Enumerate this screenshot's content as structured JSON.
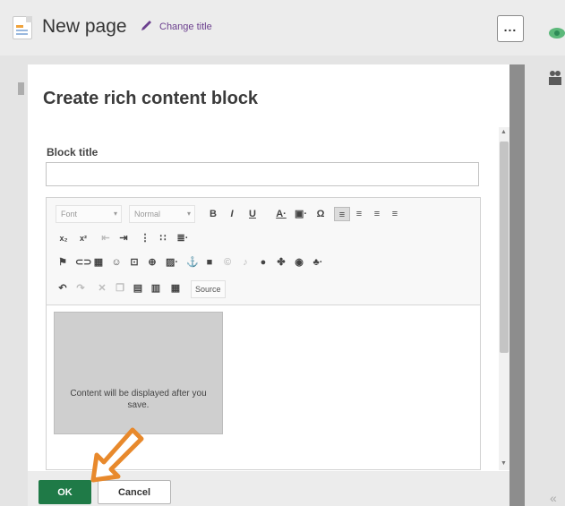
{
  "header": {
    "page_title": "New page",
    "change_title_label": "Change title",
    "more_label": "..."
  },
  "modal": {
    "title": "Create rich content block",
    "block_title_label": "Block title",
    "block_title_value": "",
    "toolbar": {
      "font_combo": "Font",
      "format_combo": "Normal",
      "source_label": "Source"
    },
    "content_placeholder": "Content will be displayed after you save.",
    "ok_label": "OK",
    "cancel_label": "Cancel"
  },
  "colors": {
    "ok_green": "#1f7a47",
    "accent_purple": "#6b3f8e",
    "callout_orange": "#e8892c"
  },
  "icons": [
    "page-icon",
    "pencil-icon",
    "more-icon",
    "eye-icon",
    "users-icon",
    "collapse-icon",
    "pointer-arrow-icon"
  ]
}
